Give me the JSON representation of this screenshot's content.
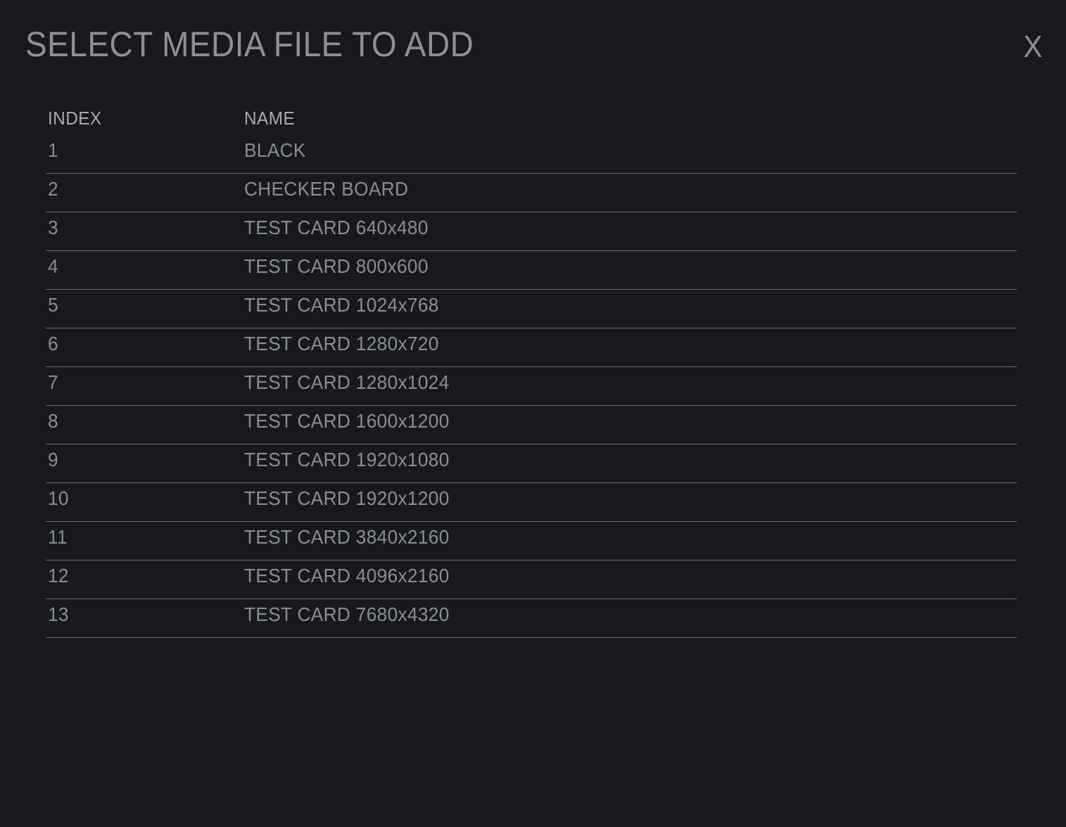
{
  "window": {
    "title": "SELECT MEDIA FILE TO ADD",
    "close_label": "X",
    "background_color": "#17191d",
    "title_color": "#8e9094",
    "header_text_color": "#a9abad",
    "row_text_color": "#8b8e91",
    "separator_color": "#6a6d71"
  },
  "table": {
    "columns": {
      "index": "INDEX",
      "name": "NAME"
    },
    "rows": [
      {
        "index": "1",
        "name": "BLACK"
      },
      {
        "index": "2",
        "name": "CHECKER BOARD"
      },
      {
        "index": "3",
        "name": "TEST CARD 640x480"
      },
      {
        "index": "4",
        "name": "TEST CARD 800x600"
      },
      {
        "index": "5",
        "name": "TEST CARD 1024x768"
      },
      {
        "index": "6",
        "name": "TEST CARD 1280x720"
      },
      {
        "index": "7",
        "name": "TEST CARD 1280x1024"
      },
      {
        "index": "8",
        "name": "TEST CARD 1600x1200"
      },
      {
        "index": "9",
        "name": "TEST CARD 1920x1080"
      },
      {
        "index": "10",
        "name": "TEST CARD 1920x1200"
      },
      {
        "index": "11",
        "name": "TEST CARD 3840x2160"
      },
      {
        "index": "12",
        "name": "TEST CARD 4096x2160"
      },
      {
        "index": "13",
        "name": "TEST CARD 7680x4320"
      }
    ]
  }
}
